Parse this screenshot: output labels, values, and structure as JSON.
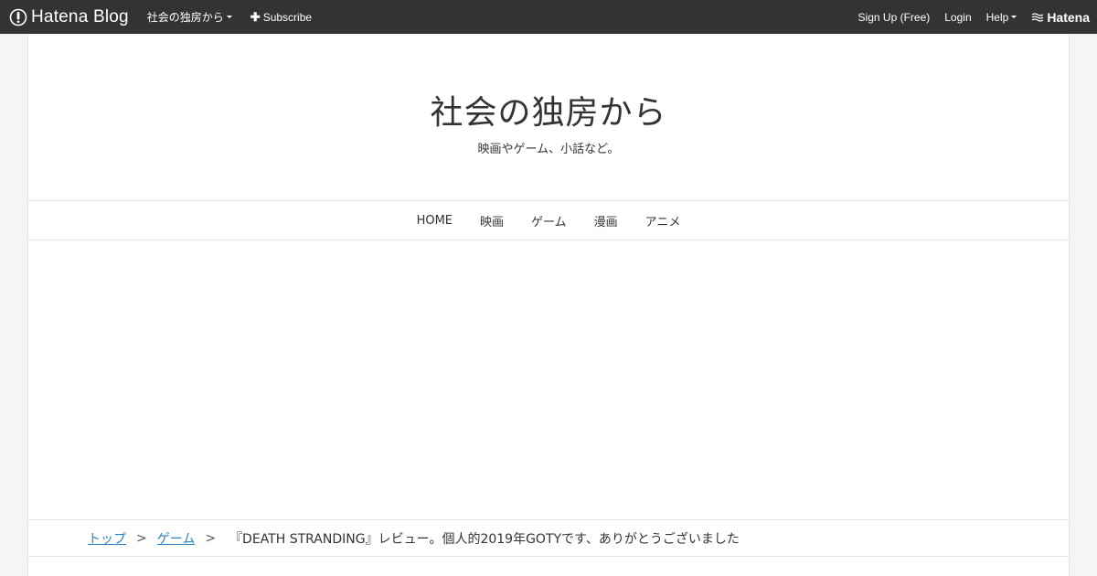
{
  "topbar": {
    "brand": "Hatena Blog",
    "blog_menu_label": "社会の独房から",
    "subscribe_label": "Subscribe",
    "signup_label": "Sign Up (Free)",
    "login_label": "Login",
    "help_label": "Help",
    "hatena_label": "Hatena"
  },
  "header": {
    "title": "社会の独房から",
    "description": "映画やゲーム、小話など。"
  },
  "nav": {
    "items": [
      {
        "label": "HOME"
      },
      {
        "label": "映画"
      },
      {
        "label": "ゲーム"
      },
      {
        "label": "漫画"
      },
      {
        "label": "アニメ"
      }
    ]
  },
  "breadcrumb": {
    "top": "トップ",
    "category": "ゲーム",
    "separator": ">",
    "current": "『DEATH STRANDING』レビュー。個人的2019年GOTYです、ありがとうございました"
  },
  "colors": {
    "topbar_bg": "#333333",
    "link": "#2a85c2",
    "page_bg": "#f5f5f5"
  }
}
